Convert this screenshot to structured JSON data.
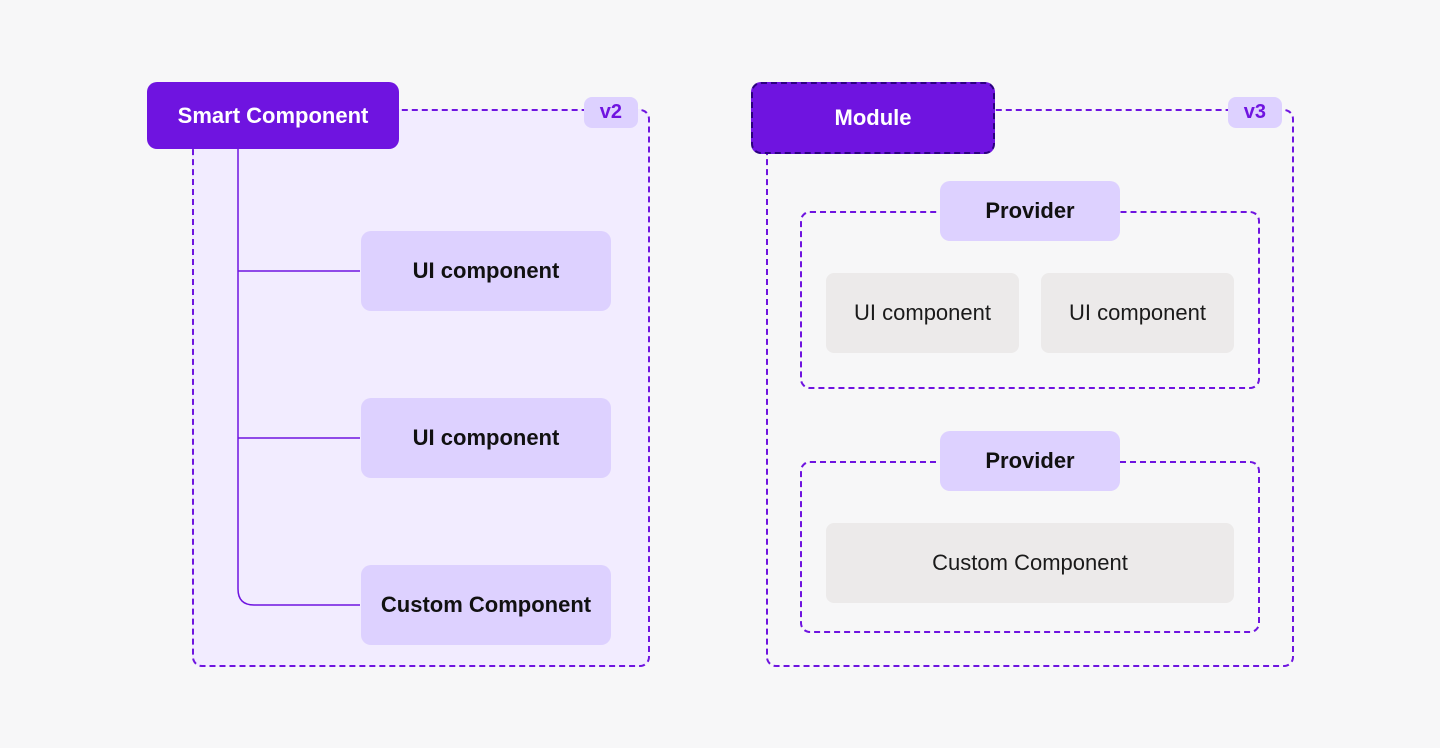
{
  "left": {
    "version": "v2",
    "header": "Smart Component",
    "children": [
      "UI component",
      "UI component",
      "Custom Component"
    ]
  },
  "right": {
    "version": "v3",
    "header": "Module",
    "providers": [
      {
        "label": "Provider",
        "items": [
          "UI component",
          "UI component"
        ]
      },
      {
        "label": "Provider",
        "items": [
          "Custom Component"
        ]
      }
    ]
  }
}
